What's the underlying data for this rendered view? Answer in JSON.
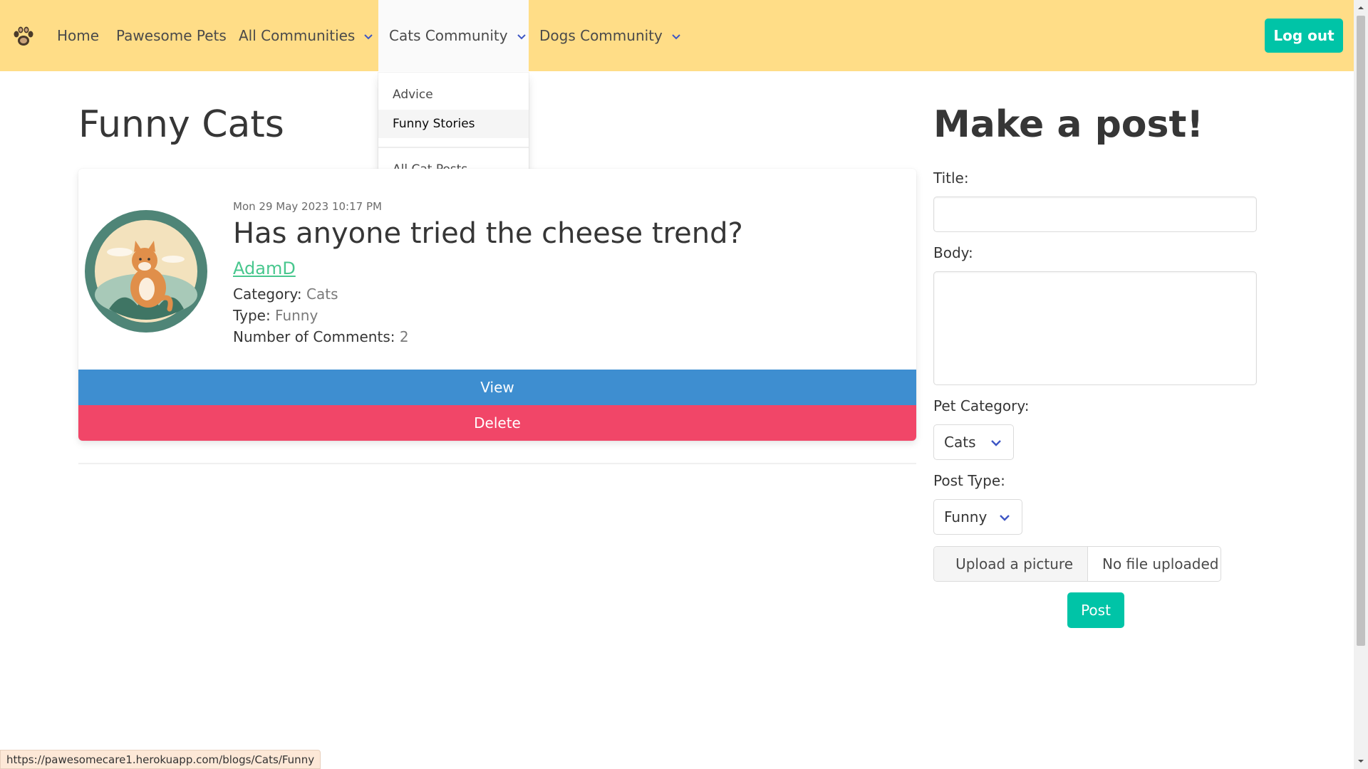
{
  "nav": {
    "logo_icon": "paw-icon",
    "home": "Home",
    "pawesome_pets": "Pawesome Pets",
    "all_communities": "All Communities",
    "cats_community": "Cats Community",
    "dogs_community": "Dogs Community",
    "logout": "Log out"
  },
  "dropdown": {
    "items": [
      "Advice",
      "Funny Stories",
      "All Cat Posts"
    ],
    "hovered": "Funny Stories"
  },
  "page": {
    "title": "Funny Cats"
  },
  "post": {
    "date": "Mon 29 May 2023 10:17 PM",
    "title": "Has anyone tried the cheese trend?",
    "author": "AdamD",
    "category_label": "Category:",
    "category": "Cats",
    "type_label": "Type:",
    "type": "Funny",
    "comments_label": "Number of Comments:",
    "comments": "2",
    "view_label": "View",
    "delete_label": "Delete"
  },
  "form": {
    "heading": "Make a post!",
    "title_label": "Title:",
    "title_value": "",
    "body_label": "Body:",
    "body_value": "",
    "category_label": "Pet Category:",
    "category_value": "Cats",
    "type_label": "Post Type:",
    "type_value": "Funny",
    "upload_label": "Upload a picture",
    "file_status": "No file uploaded",
    "submit_label": "Post"
  },
  "status_bar": {
    "url": "https://pawesomecare1.herokuapp.com/blogs/Cats/Funny"
  },
  "colors": {
    "navbar": "#ffdd87",
    "primary": "#00c4a7",
    "info": "#3e8ed0",
    "danger": "#f14668",
    "link": "#48c78e"
  }
}
